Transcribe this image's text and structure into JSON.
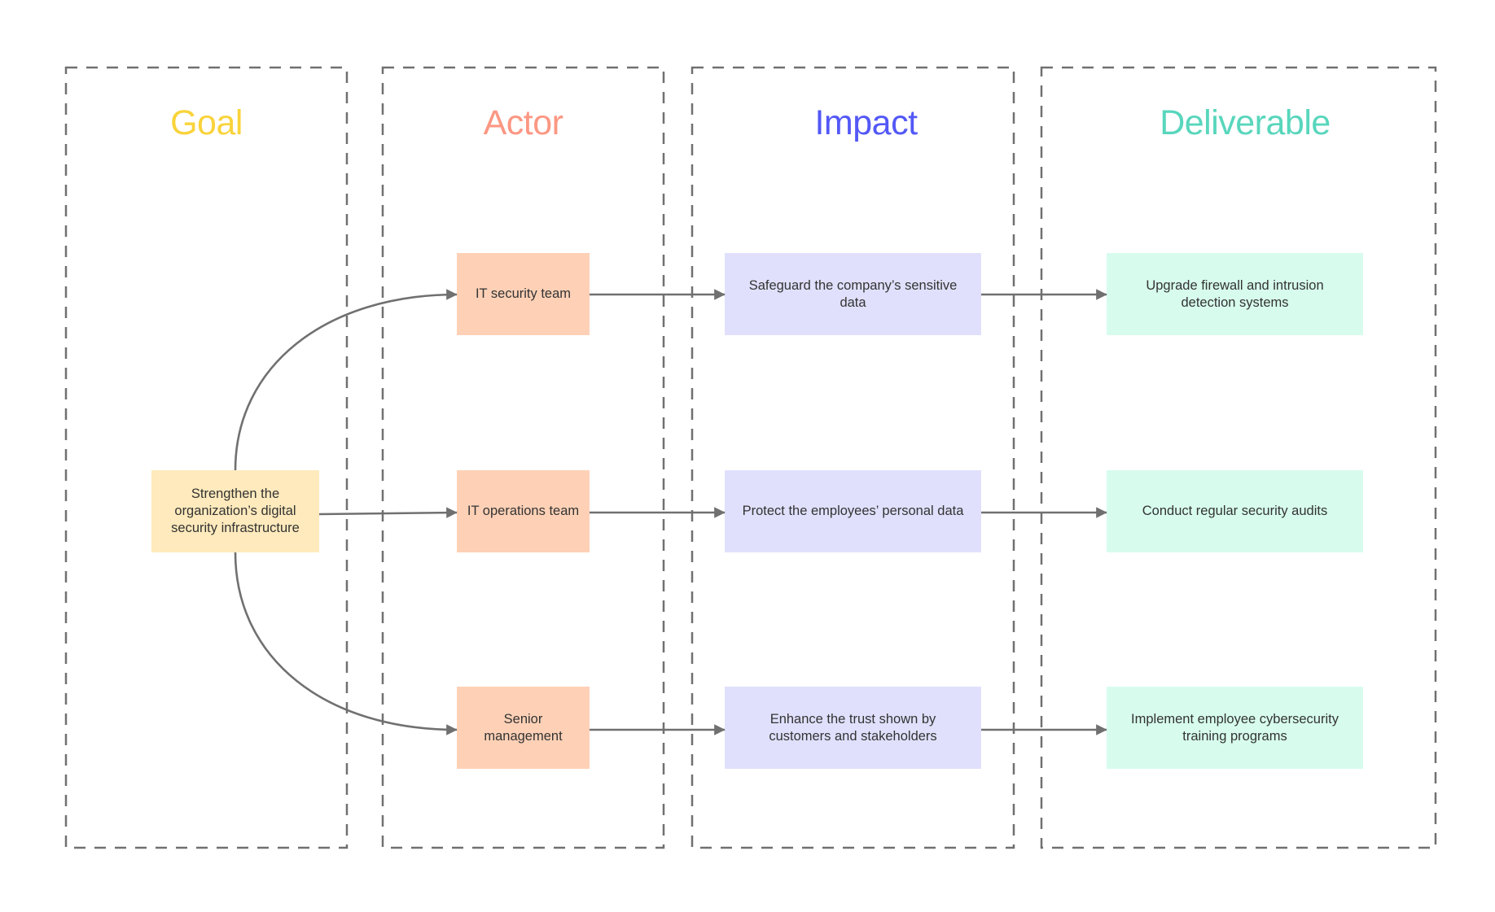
{
  "colors": {
    "goal_heading": "#F9D33A",
    "actor_heading": "#FC9783",
    "impact_heading": "#5358F6",
    "deliverable_heading": "#58D6BC",
    "goal_fill": "#FEEABC",
    "actor_fill": "#FED1B6",
    "impact_fill": "#E0E0FD",
    "deliverable_fill": "#D7FCEE",
    "connector": "#707070",
    "lane_border": "#707070",
    "text": "#333333"
  },
  "columns": [
    {
      "id": "goal",
      "heading": "Goal"
    },
    {
      "id": "actor",
      "heading": "Actor"
    },
    {
      "id": "impact",
      "heading": "Impact"
    },
    {
      "id": "deliverable",
      "heading": "Deliverable"
    }
  ],
  "goal": {
    "label": "Strengthen the organization’s digital security infrastructure"
  },
  "actors": [
    {
      "label": "IT security team"
    },
    {
      "label": "IT operations team"
    },
    {
      "label": "Senior management"
    }
  ],
  "impacts": [
    {
      "label": "Safeguard the company’s sensitive data"
    },
    {
      "label": "Protect the employees’ personal data"
    },
    {
      "label": "Enhance the trust shown by customers and stakeholders"
    }
  ],
  "deliverables": [
    {
      "label": "Upgrade firewall and intrusion detection systems"
    },
    {
      "label": "Conduct regular security audits"
    },
    {
      "label": "Implement employee cybersecurity training programs"
    }
  ],
  "connections": [
    {
      "from": "goal",
      "to": "actor-0"
    },
    {
      "from": "goal",
      "to": "actor-1"
    },
    {
      "from": "goal",
      "to": "actor-2"
    },
    {
      "from": "actor-0",
      "to": "impact-0"
    },
    {
      "from": "actor-1",
      "to": "impact-1"
    },
    {
      "from": "actor-2",
      "to": "impact-2"
    },
    {
      "from": "impact-0",
      "to": "deliverable-0"
    },
    {
      "from": "impact-1",
      "to": "deliverable-1"
    },
    {
      "from": "impact-2",
      "to": "deliverable-2"
    }
  ]
}
